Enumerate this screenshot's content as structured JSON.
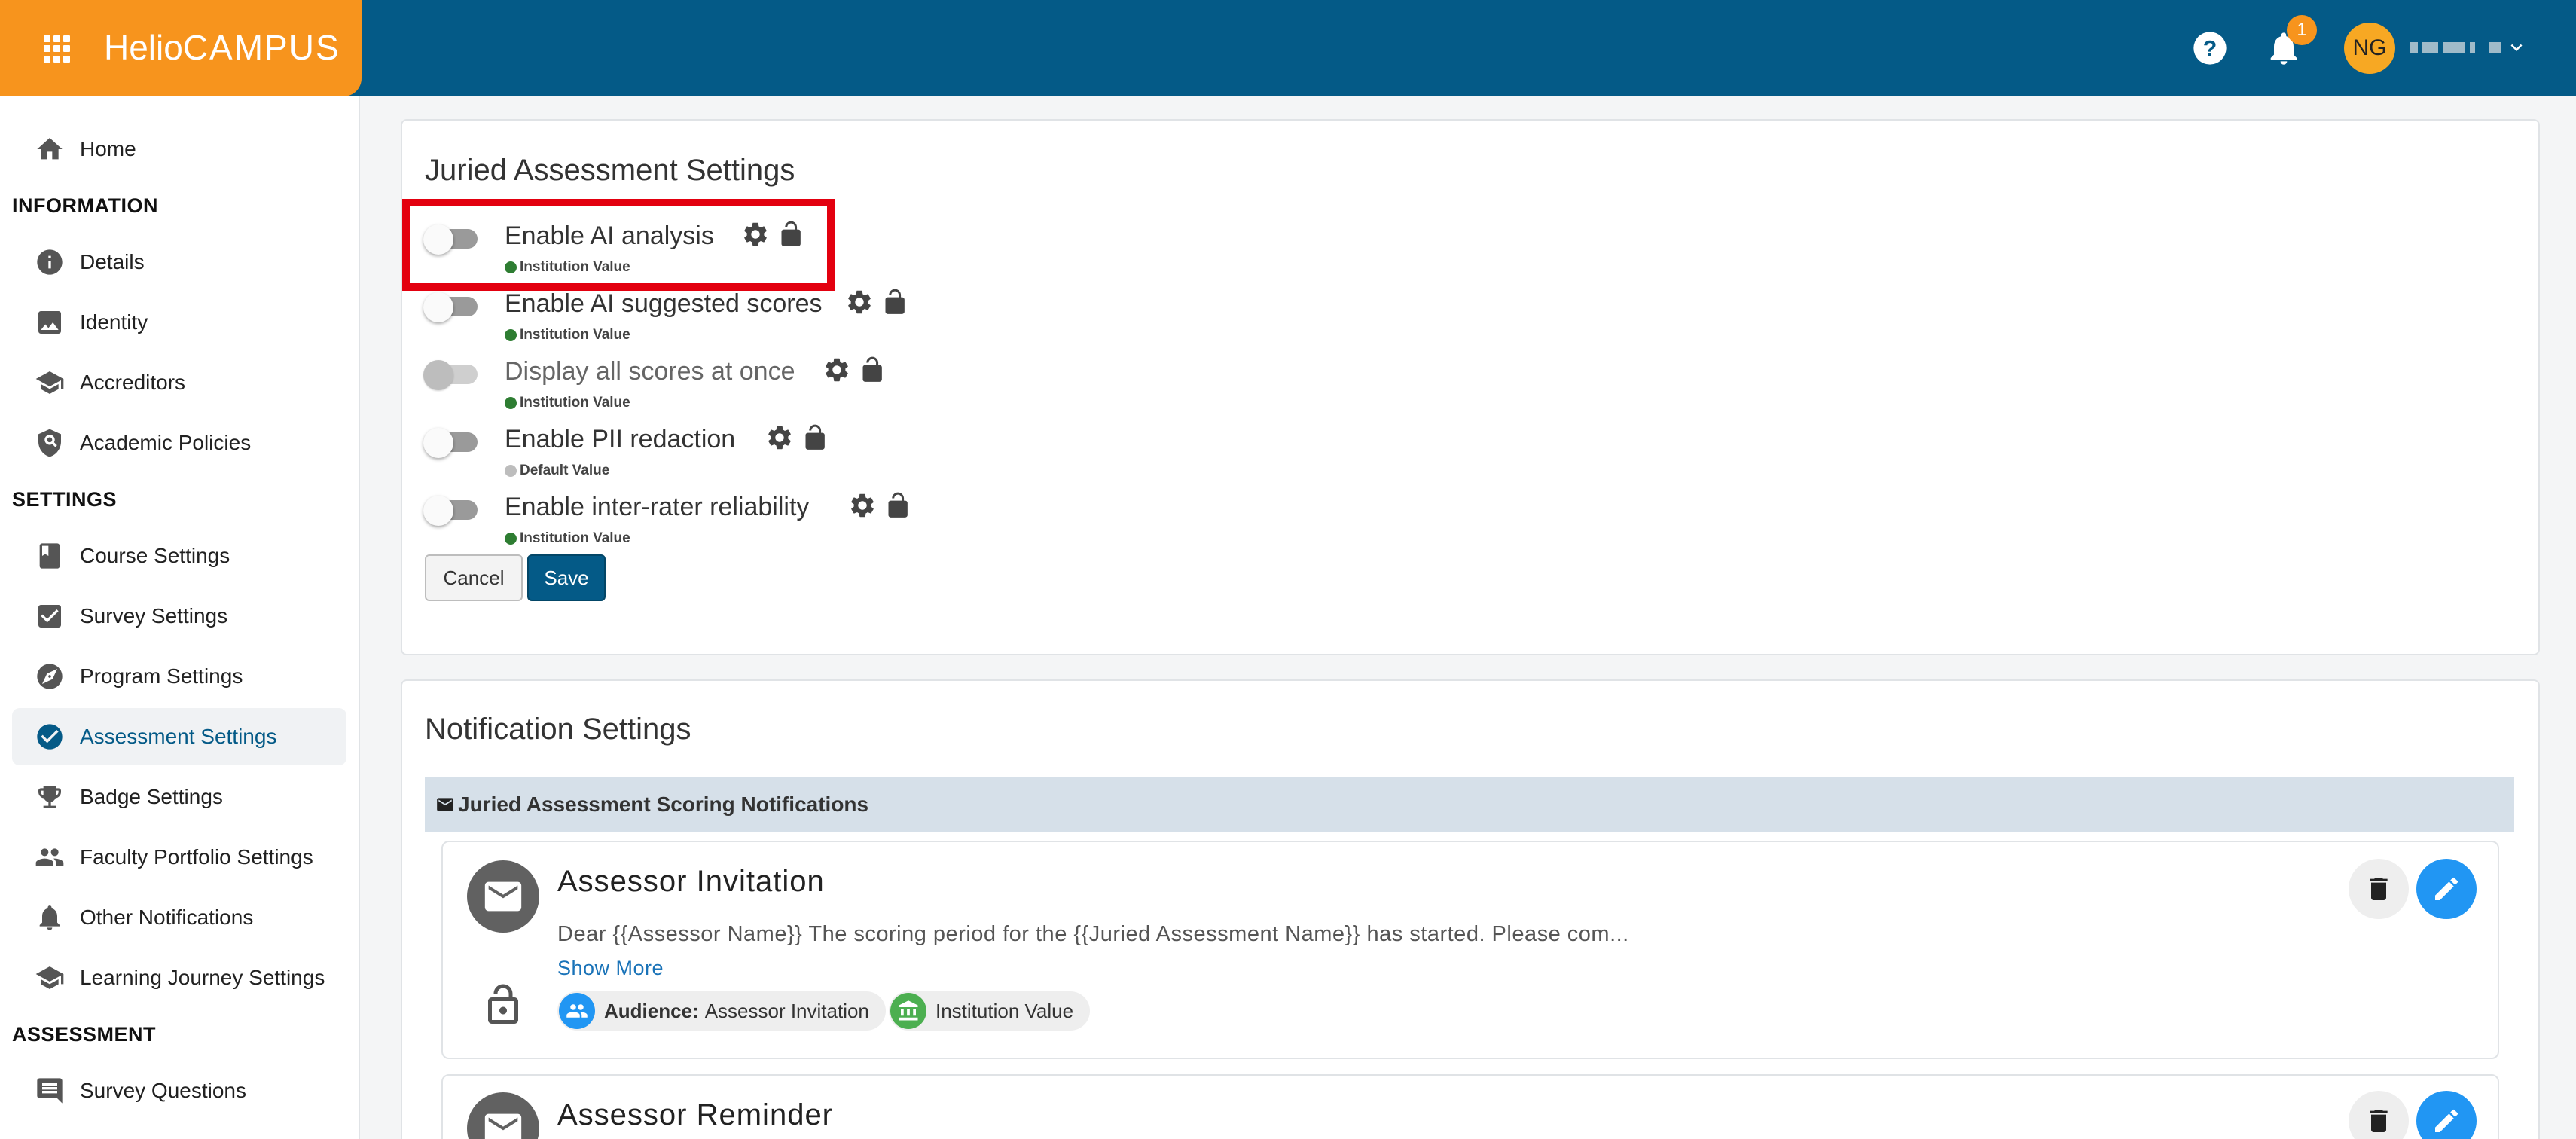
{
  "header": {
    "logo_part1": "Helio",
    "logo_part2": "CAMPUS",
    "notification_count": "1",
    "user_initials": "NG"
  },
  "sidebar": {
    "home": "Home",
    "section_information": "INFORMATION",
    "details": "Details",
    "identity": "Identity",
    "accreditors": "Accreditors",
    "academic_policies": "Academic Policies",
    "section_settings": "SETTINGS",
    "course_settings": "Course Settings",
    "survey_settings": "Survey Settings",
    "program_settings": "Program Settings",
    "assessment_settings": "Assessment Settings",
    "badge_settings": "Badge Settings",
    "faculty_portfolio_settings": "Faculty Portfolio Settings",
    "other_notifications": "Other Notifications",
    "learning_journey_settings": "Learning Journey Settings",
    "section_assessment": "ASSESSMENT",
    "survey_questions": "Survey Questions"
  },
  "juried": {
    "title": "Juried Assessment Settings",
    "settings": [
      {
        "label": "Enable AI analysis",
        "source": "Institution Value",
        "source_color": "#2e7d32",
        "enabled": false
      },
      {
        "label": "Enable AI suggested scores",
        "source": "Institution Value",
        "source_color": "#2e7d32",
        "enabled": false
      },
      {
        "label": "Display all scores at once",
        "source": "Institution Value",
        "source_color": "#2e7d32",
        "enabled": false,
        "disabled": true
      },
      {
        "label": "Enable PII redaction",
        "source": "Default Value",
        "source_color": "#bdbdbd",
        "enabled": false
      },
      {
        "label": "Enable inter-rater reliability",
        "source": "Institution Value",
        "source_color": "#2e7d32",
        "enabled": false
      }
    ],
    "cancel_label": "Cancel",
    "save_label": "Save"
  },
  "notification_settings": {
    "title": "Notification Settings",
    "section_label": "Juried Assessment Scoring Notifications",
    "items": [
      {
        "title": "Assessor Invitation",
        "body": "Dear {{Assessor Name}} The scoring period for the {{Juried Assessment Name}} has started. Please com...",
        "show_more": "Show More",
        "audience_label": "Audience:",
        "audience_value": "Assessor Invitation",
        "value_chip": "Institution Value"
      },
      {
        "title": "Assessor Reminder"
      }
    ]
  },
  "colors": {
    "header_bg": "#045a87",
    "brand_orange": "#f7941d",
    "active_text": "#045a87",
    "highlight_red": "#e3000f",
    "edit_blue": "#2196f3",
    "chip_green": "#4caf50"
  }
}
